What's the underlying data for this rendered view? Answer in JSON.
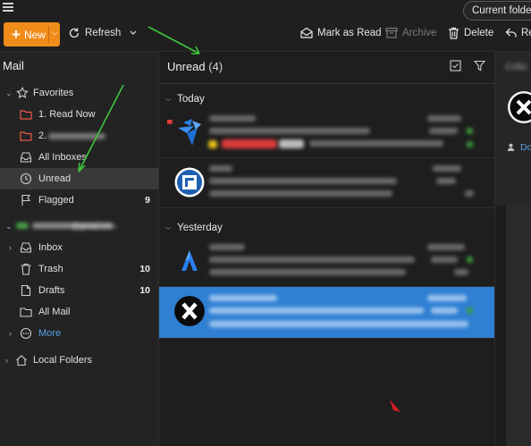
{
  "toolbar": {
    "new_label": "New",
    "refresh_label": "Refresh",
    "mark_as_read_label": "Mark as Read",
    "archive_label": "Archive",
    "delete_label": "Delete",
    "reply_label": "Rep",
    "current_folder_label": "Current folder"
  },
  "sidebar": {
    "title": "Mail",
    "favorites_label": "Favorites",
    "items": [
      {
        "label": "1. Read Now",
        "icon": "folder-icon",
        "color": "#e8584a"
      },
      {
        "label": "2.",
        "icon": "folder-icon",
        "color": "#e8584a"
      },
      {
        "label": "All Inboxes",
        "icon": "inbox-icon"
      },
      {
        "label": "Unread",
        "icon": "clock-icon"
      },
      {
        "label": "Flagged",
        "icon": "flag-icon",
        "count": "9"
      }
    ],
    "account": {
      "label": "@gmail.com",
      "items": [
        {
          "label": "Inbox",
          "icon": "inbox-icon"
        },
        {
          "label": "Trash",
          "icon": "trash-icon",
          "count": "10"
        },
        {
          "label": "Drafts",
          "icon": "drafts-icon",
          "count": "10"
        },
        {
          "label": "All Mail",
          "icon": "folder-icon"
        },
        {
          "label": "More",
          "icon": "more-icon"
        }
      ]
    },
    "local_folders_label": "Local Folders"
  },
  "message_list": {
    "title": "Unread",
    "count": "(4)",
    "groups": [
      {
        "label": "Today"
      },
      {
        "label": "Yesterday"
      }
    ]
  },
  "reading_pane": {
    "header_text": "Critic",
    "link_text": "Do"
  },
  "colors": {
    "accent_orange": "#f08c1a",
    "selection_blue": "#2f7fd3",
    "folder_red": "#e8584a",
    "annotation_green": "#3fc43f",
    "link_blue": "#5aa0e6"
  }
}
